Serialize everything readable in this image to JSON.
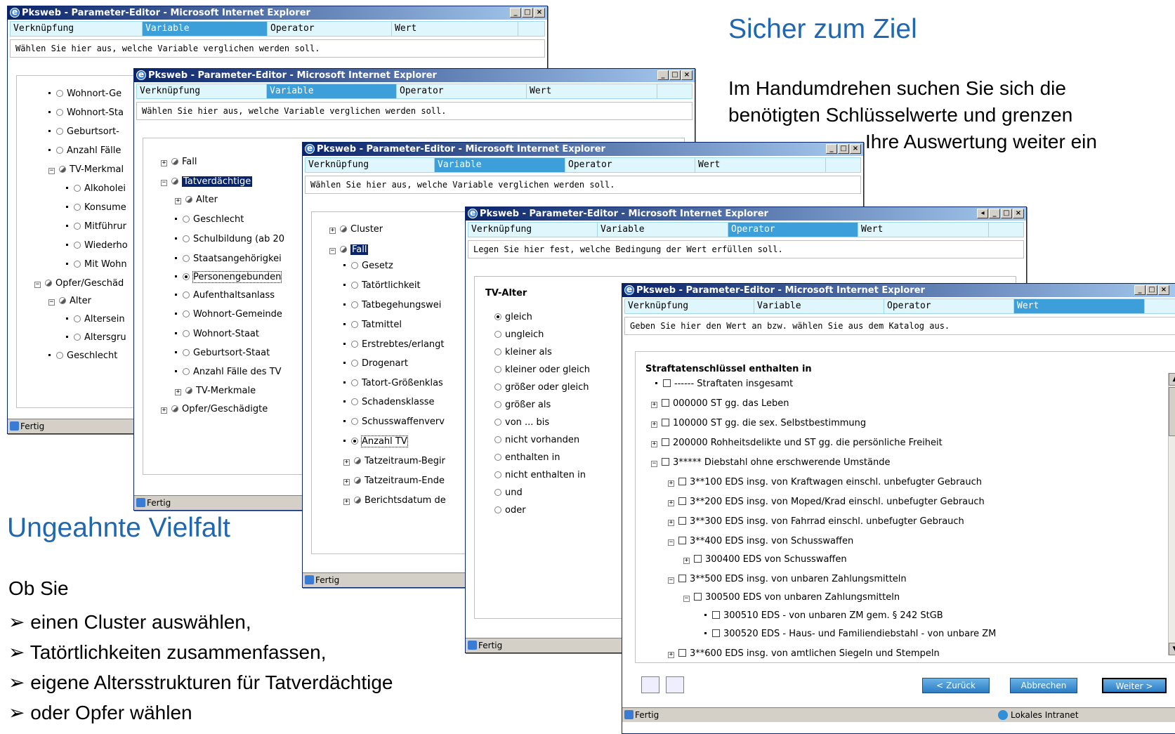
{
  "slide": {
    "heading1": "Sicher zum Ziel",
    "text1_line1": "Im Handumdrehen suchen Sie sich die",
    "text1_line2": "benötigten Schlüsselwerte und grenzen",
    "text1_line3": "Ihre Auswertung weiter ein",
    "heading2": "Ungeahnte Vielfalt",
    "intro": "Ob Sie",
    "bullets": [
      "➢ einen Cluster auswählen,",
      "➢ Tatörtlichkeiten zusammenfassen,",
      "➢ eigene Altersstrukturen für Tatverdächtige",
      "➢ oder Opfer wählen"
    ]
  },
  "window_title": "Pksweb - Parameter-Editor - Microsoft Internet Explorer",
  "tabs": [
    "Verknüpfung",
    "Variable",
    "Operator",
    "Wert"
  ],
  "win_buttons": {
    "min": "_",
    "max": "□",
    "close": "×",
    "scroll": "◂"
  },
  "status": {
    "ready": "Fertig",
    "zone": "Lokales Intranet"
  },
  "win1": {
    "instruction": "Wählen Sie hier aus, welche Variable verglichen werden soll.",
    "items": [
      "Wohnort-Ge",
      "Wohnort-Sta",
      "Geburtsort-",
      "Anzahl Fälle",
      "TV-Merkmal",
      "Alkoholei",
      "Konsume",
      "Mitführur",
      "Wiederho",
      "Mit Wohn",
      "Opfer/Geschäd",
      "Alter",
      "Altersein",
      "Altersgru",
      "Geschlecht"
    ]
  },
  "win2": {
    "instruction": "Wählen Sie hier aus, welche Variable verglichen werden soll.",
    "items": [
      "Fall",
      "Tatverdächtige",
      "Alter",
      "Geschlecht",
      "Schulbildung (ab 20",
      "Staatsangehörigkei",
      "Personengebunden",
      "Aufenthaltsanlass",
      "Wohnort-Gemeinde",
      "Wohnort-Staat",
      "Geburtsort-Staat",
      "Anzahl Fälle des TV",
      "TV-Merkmale",
      "Opfer/Geschädigte"
    ]
  },
  "win3": {
    "instruction": "Wählen Sie hier aus, welche Variable verglichen werden soll.",
    "items": [
      "Cluster",
      "Fall",
      "Gesetz",
      "Tatörtlichkeit",
      "Tatbegehungswei",
      "Tatmittel",
      "Erstrebtes/erlangt",
      "Drogenart",
      "Tatort-Größenklas",
      "Schadensklasse",
      "Schusswaffenverv",
      "Anzahl TV",
      "Tatzeitraum-Begir",
      "Tatzeitraum-Ende",
      "Berichtsdatum de"
    ]
  },
  "win4": {
    "instruction": "Legen Sie hier fest, welche Bedingung der Wert erfüllen soll.",
    "heading": "TV-Alter",
    "operators": [
      "gleich",
      "ungleich",
      "kleiner als",
      "kleiner oder gleich",
      "größer oder gleich",
      "größer als",
      "von ... bis",
      "nicht vorhanden",
      "enthalten in",
      "nicht enthalten in",
      "und",
      "oder"
    ],
    "selected": "gleich"
  },
  "win5": {
    "instruction": "Geben Sie hier den Wert an bzw. wählen Sie aus dem Katalog aus.",
    "heading": "Straftatenschlüssel enthalten in",
    "items": [
      "------ Straftaten insgesamt",
      "000000 ST gg. das Leben",
      "100000 ST gg. die sex. Selbstbestimmung",
      "200000 Rohheitsdelikte und ST gg. die persönliche Freiheit",
      "3***** Diebstahl ohne erschwerende Umstände",
      "3**100 EDS insg. von Kraftwagen einschl. unbefugter Gebrauch",
      "3**200 EDS insg. von Moped/Krad einschl. unbefugter Gebrauch",
      "3**300 EDS insg. von Fahrrad einschl. unbefugter Gebrauch",
      "3**400 EDS insg. von Schusswaffen",
      "300400 EDS von Schusswaffen",
      "3**500 EDS insg. von unbaren Zahlungsmitteln",
      "300500 EDS von unbaren Zahlungsmitteln",
      "300510 EDS - von unbaren ZM gem. § 242 StGB",
      "300520 EDS - Haus- und Familiendiebstahl - von unbare ZM",
      "3**600 EDS insg. von amtlichen Siegeln und Stempeln"
    ],
    "back": "< Zurück",
    "cancel": "Abbrechen",
    "next": "Weiter >"
  }
}
